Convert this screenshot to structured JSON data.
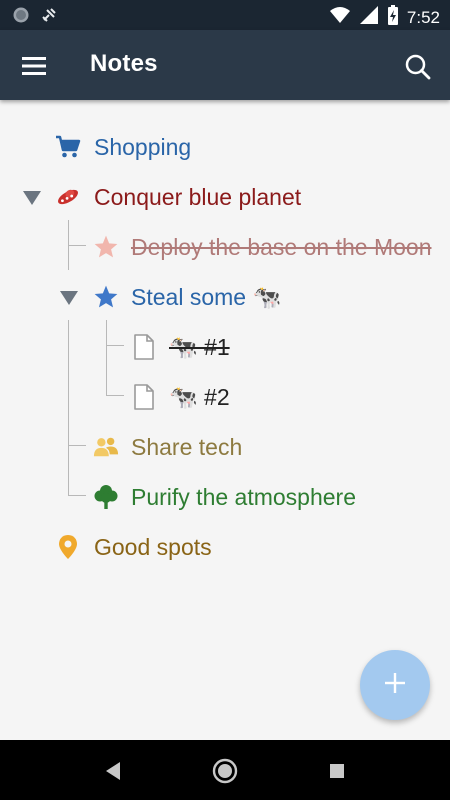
{
  "status_bar": {
    "time": "7:52",
    "icons": [
      "circle-notification-icon",
      "satellite-notification-icon",
      "wifi-icon",
      "cell-signal-icon",
      "battery-charging-icon"
    ]
  },
  "app_bar": {
    "title": "Notes",
    "menu_icon": "hamburger-menu-icon",
    "search_icon": "search-icon"
  },
  "tree": {
    "items": [
      {
        "label": "Shopping",
        "icon": "cart-icon",
        "color": "#2a65a8",
        "done": false
      },
      {
        "label": "Conquer blue planet",
        "icon": "ufo-icon",
        "color": "#8b1a1a",
        "done": false,
        "expanded": true
      },
      {
        "label": "Deploy the base on the Moon",
        "icon": "star-icon",
        "color": "#b07a78",
        "done": true
      },
      {
        "label": "Steal some 🐄",
        "icon": "star-icon",
        "color": "#2a65a8",
        "done": false,
        "expanded": true
      },
      {
        "label": "🐄 #1",
        "icon": "document-icon",
        "color": "#222222",
        "done": true
      },
      {
        "label": "🐄 #2",
        "icon": "document-icon",
        "color": "#222222",
        "done": false
      },
      {
        "label": "Share tech",
        "icon": "people-icon",
        "color": "#8d7a40",
        "done": false
      },
      {
        "label": "Purify the atmosphere",
        "icon": "tree-icon",
        "color": "#2e7d32",
        "done": false
      },
      {
        "label": "Good spots",
        "icon": "location-pin-icon",
        "color": "#8a6416",
        "done": false
      }
    ]
  },
  "fab": {
    "icon": "plus-icon",
    "color": "#a3c9ef"
  },
  "nav_bar": {
    "back_icon": "back-triangle-icon",
    "home_icon": "home-circle-icon",
    "recents_icon": "recents-square-icon"
  }
}
